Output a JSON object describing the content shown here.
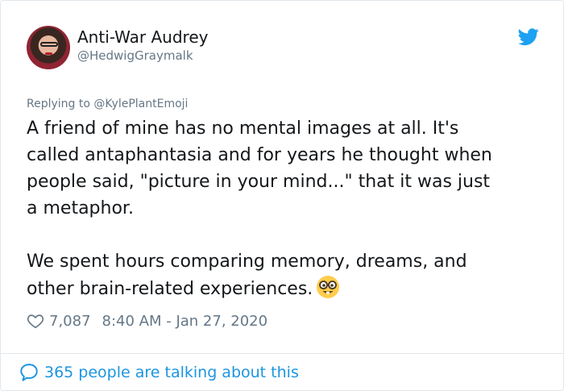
{
  "tweet": {
    "author": {
      "display_name": "Anti-War Audrey",
      "handle": "@HedwigGraymalk"
    },
    "replying_to": {
      "prefix": "Replying to",
      "mention": "@KylePlantEmoji"
    },
    "body": "A friend of mine has no mental images at all. It's\ncalled antaphantasia and for years he thought when\npeople said, \"picture in your mind...\" that it was just\na metaphor.\n\nWe spent hours comparing memory, dreams, and\nother brain-related experiences.",
    "like_count": "7,087",
    "timestamp": "8:40 AM - Jan 27, 2020",
    "talking": "365 people are talking about this"
  },
  "icons": {
    "brand": "twitter-bird-icon",
    "like": "heart-outline-icon",
    "conversation": "speech-bubble-icon",
    "emoji": "nerd-face-emoji-icon"
  },
  "colors": {
    "brand_blue": "#1da1f2",
    "link_blue": "#1b95e0",
    "secondary_text": "#657786",
    "primary_text": "#14171a",
    "border": "#e1e8ed"
  }
}
